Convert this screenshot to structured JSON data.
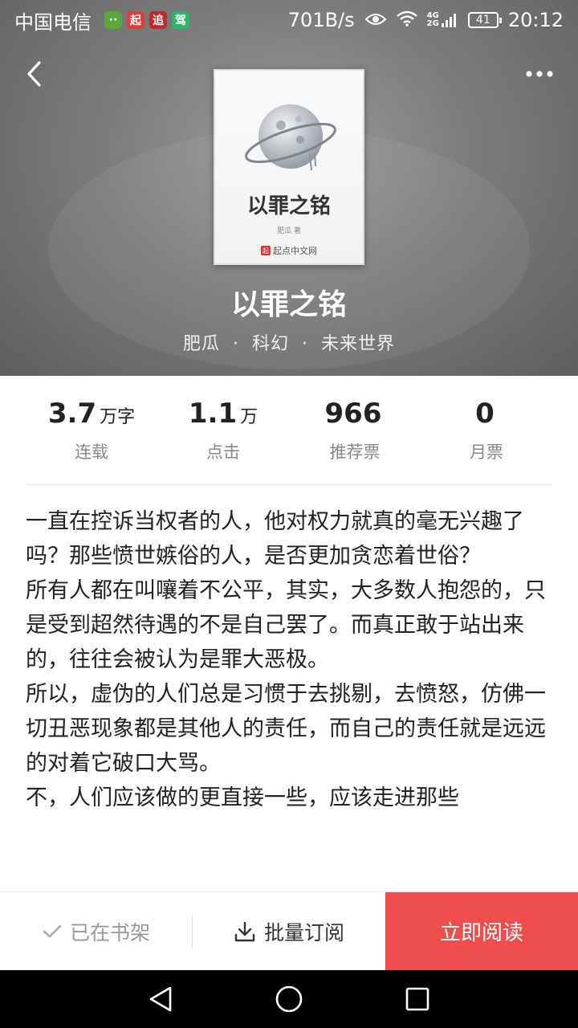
{
  "status_bar": {
    "carrier": "中国电信",
    "app_badges": [
      {
        "label": "··",
        "color": "#5aa83c"
      },
      {
        "label": "起",
        "color": "#e33b3b"
      },
      {
        "label": "追",
        "color": "#c0282d"
      },
      {
        "label": "驾",
        "color": "#2fb56a"
      }
    ],
    "network_speed": "701B/s",
    "network_type_top": "4G",
    "network_type_bottom": "2G",
    "battery": "41",
    "time": "20:12"
  },
  "book": {
    "cover_title": "以罪之铭",
    "cover_author": "肥瓜 著",
    "cover_publisher": "起点中文网",
    "cover_publisher_logo": "起",
    "title": "以罪之铭",
    "author": "肥瓜",
    "category": "科幻",
    "subcategory": "未来世界",
    "separator": "·"
  },
  "stats": [
    {
      "value": "3.7",
      "unit": "万字",
      "label": "连载"
    },
    {
      "value": "1.1",
      "unit": "万",
      "label": "点击"
    },
    {
      "value": "966",
      "unit": "",
      "label": "推荐票"
    },
    {
      "value": "0",
      "unit": "",
      "label": "月票"
    }
  ],
  "intro": {
    "paragraphs": [
      "一直在控诉当权者的人，他对权力就真的毫无兴趣了吗？那些愤世嫉俗的人，是否更加贪恋着世俗？",
      "所有人都在叫嚷着不公平，其实，大多数人抱怨的，只是受到超然待遇的不是自己罢了。而真正敢于站出来的，往往会被认为是罪大恶极。",
      "所以，虚伪的人们总是习惯于去挑剔，去愤怒，仿佛一切丑恶现象都是其他人的责任，而自己的责任就是远远的对着它破口大骂。",
      "不，人们应该做的更直接一些，应该走进那些"
    ]
  },
  "actions": {
    "shelf_label": "已在书架",
    "batch_label": "批量订阅",
    "read_label": "立即阅读",
    "read_color": "#ef4c4c"
  }
}
